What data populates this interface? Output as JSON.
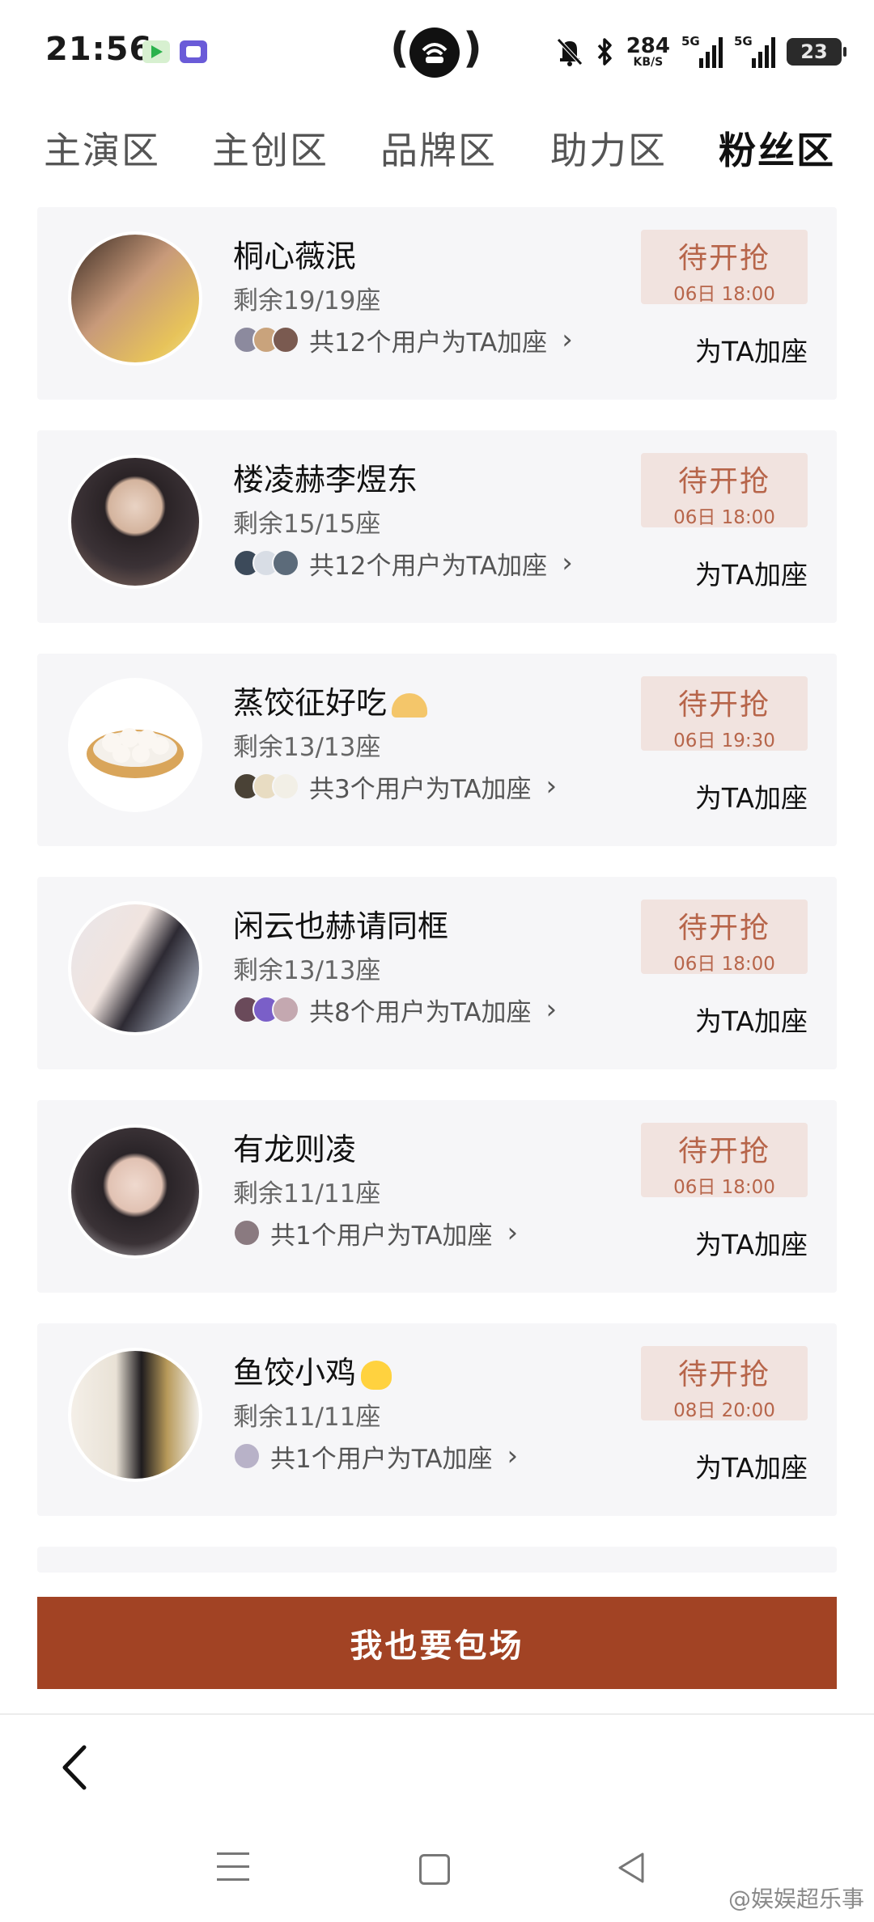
{
  "status_bar": {
    "time": "21:56",
    "net_speed_value": "284",
    "net_speed_unit": "KB/S",
    "sim1_label": "5G",
    "sim2_label": "5G",
    "battery_level": "23"
  },
  "tabs": [
    {
      "label": "主演区"
    },
    {
      "label": "主创区"
    },
    {
      "label": "品牌区"
    },
    {
      "label": "助力区"
    },
    {
      "label": "粉丝区"
    }
  ],
  "active_tab": "粉丝区",
  "cards": [
    {
      "name": "桐心薇泯",
      "remaining": "剩余19/19座",
      "users_text": "共12个用户为TA加座",
      "status": "待开抢",
      "time": "06日 18:00",
      "action": "为TA加座"
    },
    {
      "name": "楼凌赫李煜东",
      "remaining": "剩余15/15座",
      "users_text": "共12个用户为TA加座",
      "status": "待开抢",
      "time": "06日 18:00",
      "action": "为TA加座"
    },
    {
      "name": "蒸饺征好吃",
      "remaining": "剩余13/13座",
      "users_text": "共3个用户为TA加座",
      "status": "待开抢",
      "time": "06日 19:30",
      "action": "为TA加座"
    },
    {
      "name": "闲云也赫请同框",
      "remaining": "剩余13/13座",
      "users_text": "共8个用户为TA加座",
      "status": "待开抢",
      "time": "06日 18:00",
      "action": "为TA加座"
    },
    {
      "name": "有龙则凌",
      "remaining": "剩余11/11座",
      "users_text": "共1个用户为TA加座",
      "status": "待开抢",
      "time": "06日 18:00",
      "action": "为TA加座"
    },
    {
      "name": "鱼饺小鸡",
      "remaining": "剩余11/11座",
      "users_text": "共1个用户为TA加座",
      "status": "待开抢",
      "time": "08日 20:00",
      "action": "为TA加座"
    }
  ],
  "cta_label": "我也要包场",
  "watermark": "@娱娱超乐事",
  "colors": {
    "accent": "#a24324",
    "badge_bg": "#f1e3df",
    "badge_text": "#b7654a",
    "card_bg": "#f6f6f8"
  },
  "icons": [
    "app-icon-green",
    "app-icon-purple",
    "hotspot-icon",
    "mute-icon",
    "bluetooth-icon",
    "signal-icon",
    "battery-icon",
    "chevron-right-icon",
    "back-arrow-icon",
    "menu-icon",
    "home-icon",
    "nav-back-icon"
  ]
}
